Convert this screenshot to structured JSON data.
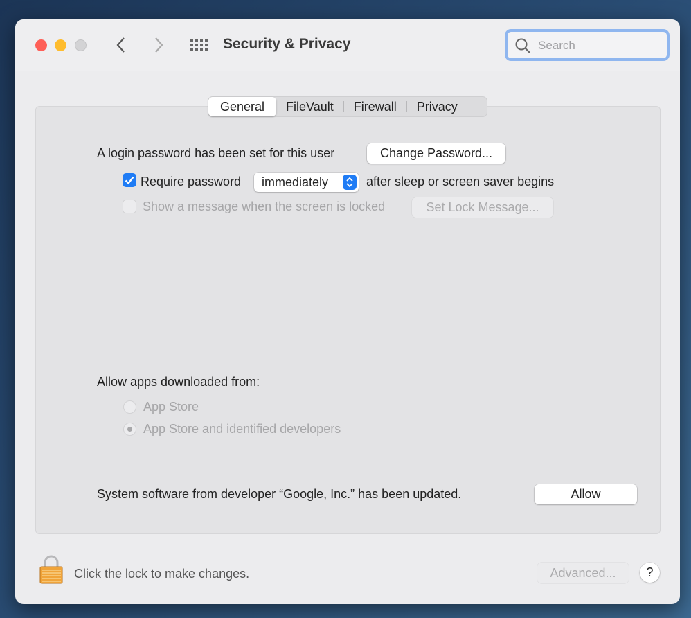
{
  "window": {
    "title": "Security & Privacy"
  },
  "toolbar": {
    "search_placeholder": "Search"
  },
  "tabs": [
    {
      "label": "General",
      "selected": true
    },
    {
      "label": "FileVault"
    },
    {
      "label": "Firewall"
    },
    {
      "label": "Privacy"
    }
  ],
  "general": {
    "login_text": "A login password has been set for this user",
    "change_password_label": "Change Password...",
    "require_password_label": "Require password",
    "require_password_checked": true,
    "require_password_value": "immediately",
    "after_sleep_text": "after sleep or screen saver begins",
    "show_message_label": "Show a message when the screen is locked",
    "show_message_checked": false,
    "set_lock_message_label": "Set Lock Message...",
    "allow_apps_label": "Allow apps downloaded from:",
    "radio_options": [
      {
        "label": "App Store",
        "selected": false
      },
      {
        "label": "App Store and identified developers",
        "selected": true
      }
    ],
    "system_software_text": "System software from developer “Google, Inc.” has been updated.",
    "allow_label": "Allow"
  },
  "footer": {
    "lock_text": "Click the lock to make changes.",
    "advanced_label": "Advanced...",
    "help_label": "?"
  },
  "colors": {
    "accent": "#1f7cf5",
    "close": "#fe5f57",
    "minimize": "#febc2e",
    "focus_ring": "#8fb6ef"
  }
}
